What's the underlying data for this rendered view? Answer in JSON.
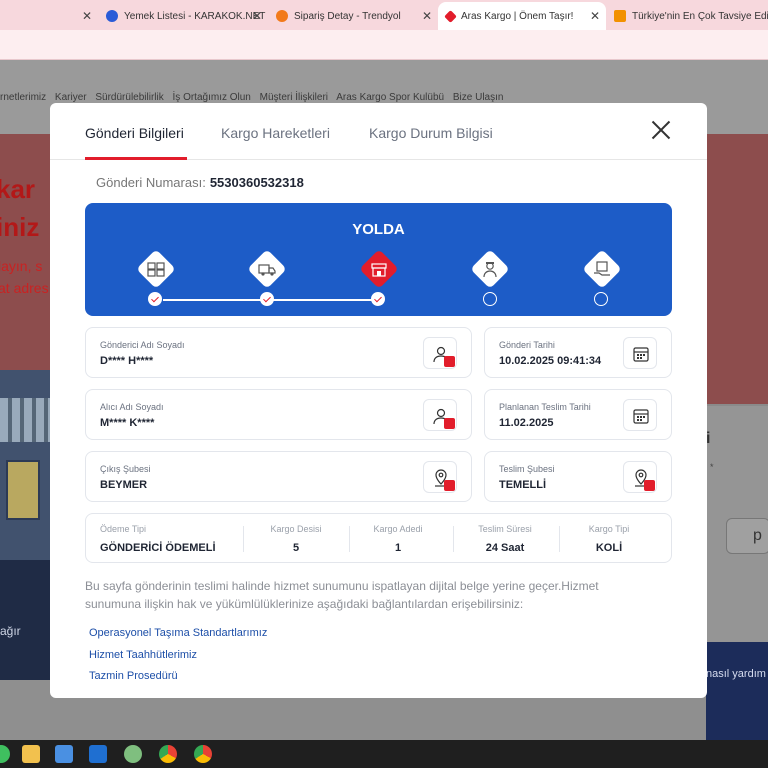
{
  "browser": {
    "tabs": [
      {
        "label": "",
        "active": false
      },
      {
        "label": "Yemek Listesi - KARAKOK.NET",
        "active": false,
        "favicon_color": "#2a5bd7"
      },
      {
        "label": "Sipariş Detay - Trendyol",
        "active": false,
        "favicon_color": "#f27a1a"
      },
      {
        "label": "Aras Kargo | Önem Taşır!",
        "active": true,
        "favicon_color": "#e21d2b"
      },
      {
        "label": "Türkiye'nin En Çok Tavsiye Edile",
        "active": false,
        "favicon_color": "#f29100"
      }
    ]
  },
  "page": {
    "nav_links": [
      "rnetlerimiz",
      "Kariyer",
      "Sürdürülebilirlik",
      "İş Ortağımız Olun",
      "Müşteri İlişkileri",
      "Aras Kargo Spor Kulübü",
      "Bize Ulaşın"
    ],
    "hero_lines": [
      "kar",
      "iniz"
    ],
    "hero_sub": [
      "layın, s",
      "at adres"
    ],
    "left_bottom_text": "ağır",
    "right_card_text": "i",
    "right_card_sub": "*",
    "right_button": "p",
    "right_blue_text": "nasıl yardım"
  },
  "modal": {
    "tabs": [
      "Gönderi Bilgileri",
      "Kargo Hareketleri",
      "Kargo Durum Bilgisi"
    ],
    "tracking_label": "Gönderi Numarası:",
    "tracking_number": "5530360532318",
    "status": "YOLDA",
    "steps_completed": 3,
    "steps_total": 5,
    "step_icons": [
      "boxes-icon",
      "truck-icon",
      "store-icon",
      "courier-icon",
      "delivered-box-icon"
    ],
    "fields": {
      "sender_label": "Gönderici Adı Soyadı",
      "sender_value": "D**** H****",
      "send_date_label": "Gönderi Tarihi",
      "send_date_value": "10.02.2025 09:41:34",
      "receiver_label": "Alıcı Adı Soyadı",
      "receiver_value": "M**** K****",
      "planned_date_label": "Planlanan Teslim Tarihi",
      "planned_date_value": "11.02.2025",
      "origin_label": "Çıkış Şubesi",
      "origin_value": "BEYMER",
      "delivery_branch_label": "Teslim Şubesi",
      "delivery_branch_value": "TEMELLİ"
    },
    "summary": [
      {
        "label": "Ödeme Tipi",
        "value": "GÖNDERİCİ ÖDEMELİ"
      },
      {
        "label": "Kargo Desisi",
        "value": "5"
      },
      {
        "label": "Kargo Adedi",
        "value": "1"
      },
      {
        "label": "Teslim Süresi",
        "value": "24 Saat"
      },
      {
        "label": "Kargo Tipi",
        "value": "KOLİ"
      }
    ],
    "info_text": "Bu sayfa gönderinin teslimi halinde hizmet sunumunu ispatlayan dijital belge yerine geçer.Hizmet sunumuna ilişkin hak ve yükümlülüklerinize aşağıdaki bağlantılardan erişebilirsiniz:",
    "links": [
      "Operasyonel Taşıma Standartlarımız",
      "Hizmet Taahhütlerimiz",
      "Tazmin Prosedürü"
    ]
  },
  "colors": {
    "brand_red": "#e21d2b",
    "status_blue": "#1d5cc7",
    "link_blue": "#1d4fa8"
  }
}
